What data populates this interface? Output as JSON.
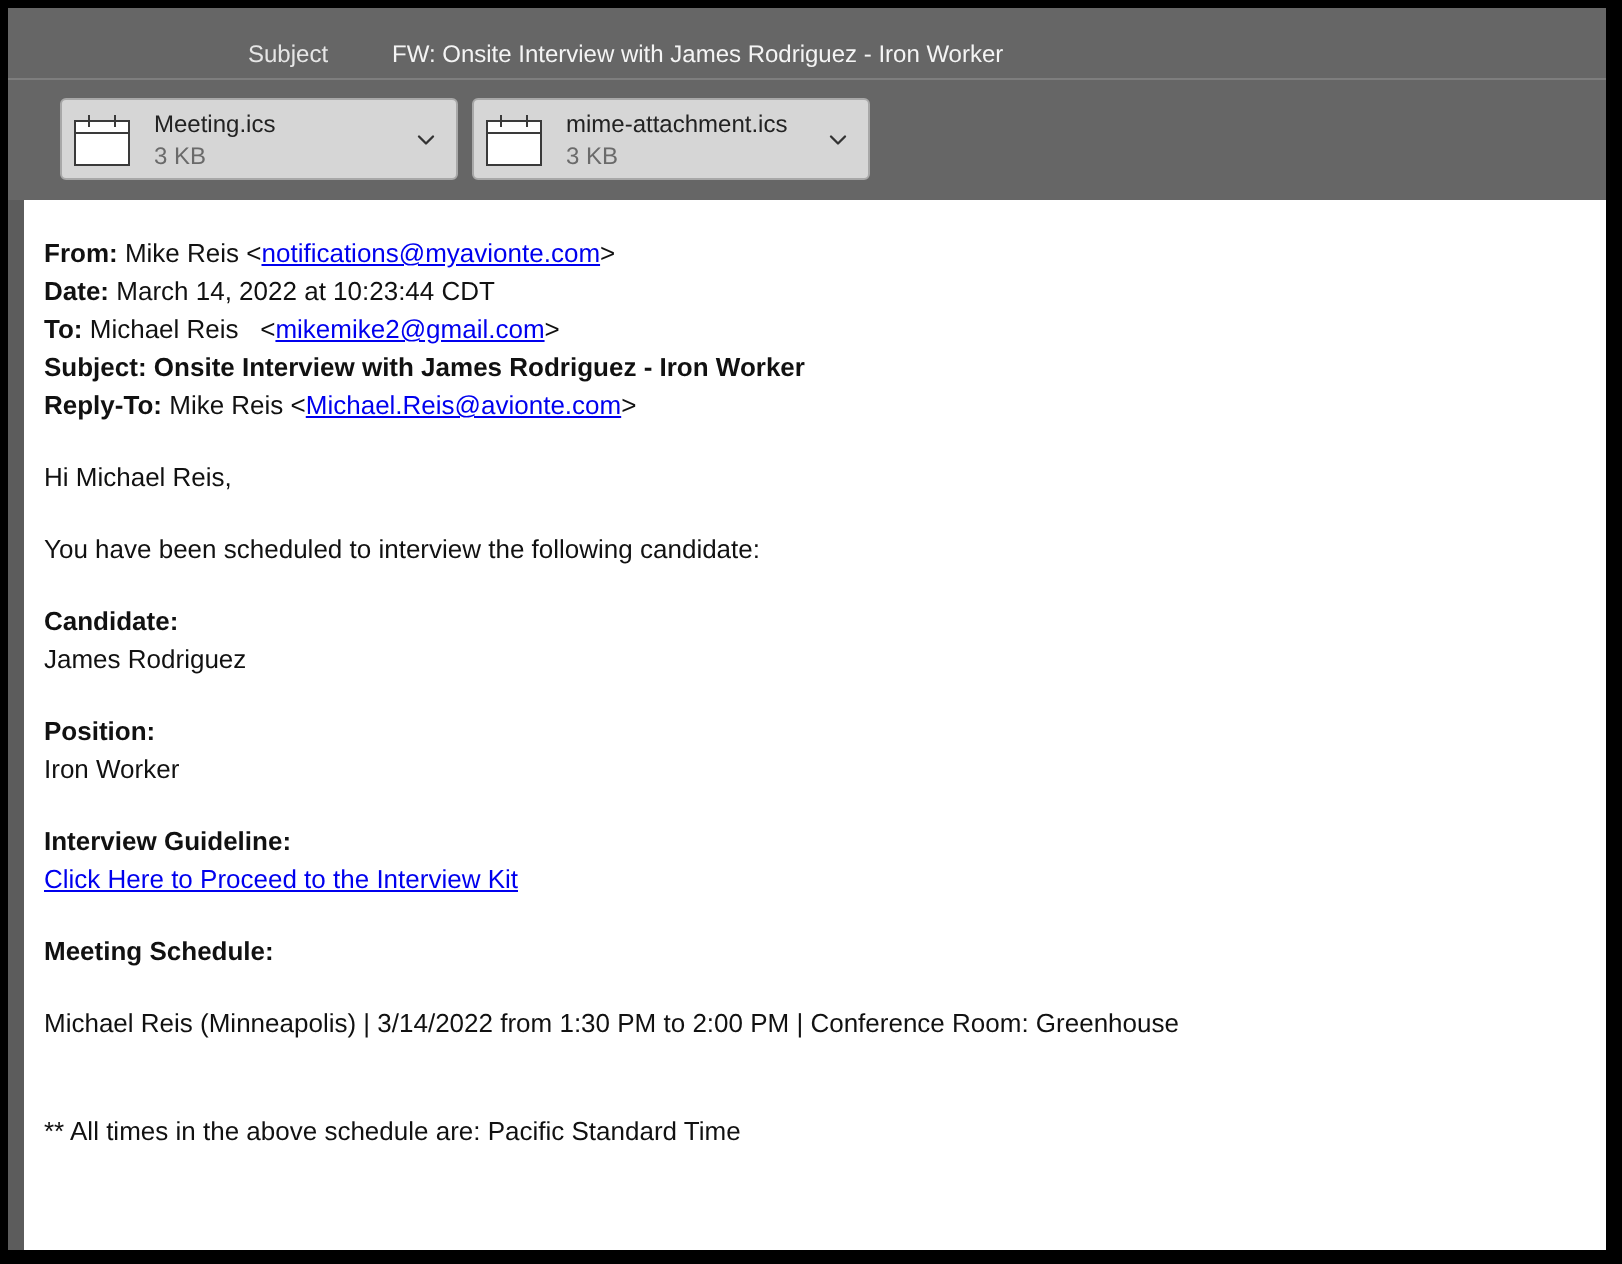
{
  "header": {
    "subject_label": "Subject",
    "subject": "FW: Onsite Interview with James Rodriguez - Iron Worker"
  },
  "attachments": [
    {
      "name": "Meeting.ics",
      "size": "3 KB"
    },
    {
      "name": "mime-attachment.ics",
      "size": "3 KB"
    }
  ],
  "message_headers": [
    {
      "label": "From:",
      "value": "Mike Reis <",
      "link": "notifications@myavionte.com",
      "end": ">",
      "bold": false
    },
    {
      "label": "Date:",
      "value": "March 14, 2022 at 10:23:44 CDT",
      "bold": false
    },
    {
      "label": "To:",
      "value": "Michael Reis   <",
      "link": "mikemike2@gmail.com",
      "end": ">",
      "bold": false
    },
    {
      "label": "Subject:",
      "value": "Onsite Interview with James Rodriguez - Iron Worker",
      "bold": true
    },
    {
      "label": "Reply-To:",
      "value": "Mike Reis <",
      "link": "Michael.Reis@avionte.com",
      "end": ">",
      "bold": false
    }
  ],
  "body": [
    {
      "kind": "paragraph",
      "text": "Hi Michael Reis,"
    },
    {
      "kind": "paragraph",
      "text": "You have been scheduled to interview the following candidate:"
    },
    {
      "kind": "field",
      "label": "Candidate:",
      "value": "James Rodriguez"
    },
    {
      "kind": "field",
      "label": "Position:",
      "value": "Iron Worker"
    },
    {
      "kind": "link_field",
      "label": "Interview Guideline:",
      "link": "Click Here to Proceed to the Interview Kit"
    },
    {
      "kind": "heading",
      "text": "Meeting Schedule:"
    },
    {
      "kind": "paragraph",
      "text": "Michael Reis (Minneapolis) | 3/14/2022 from 1:30 PM to 2:00 PM | Conference Room: Greenhouse"
    },
    {
      "kind": "note",
      "text": "** All times in the above schedule are: Pacific Standard Time"
    }
  ]
}
